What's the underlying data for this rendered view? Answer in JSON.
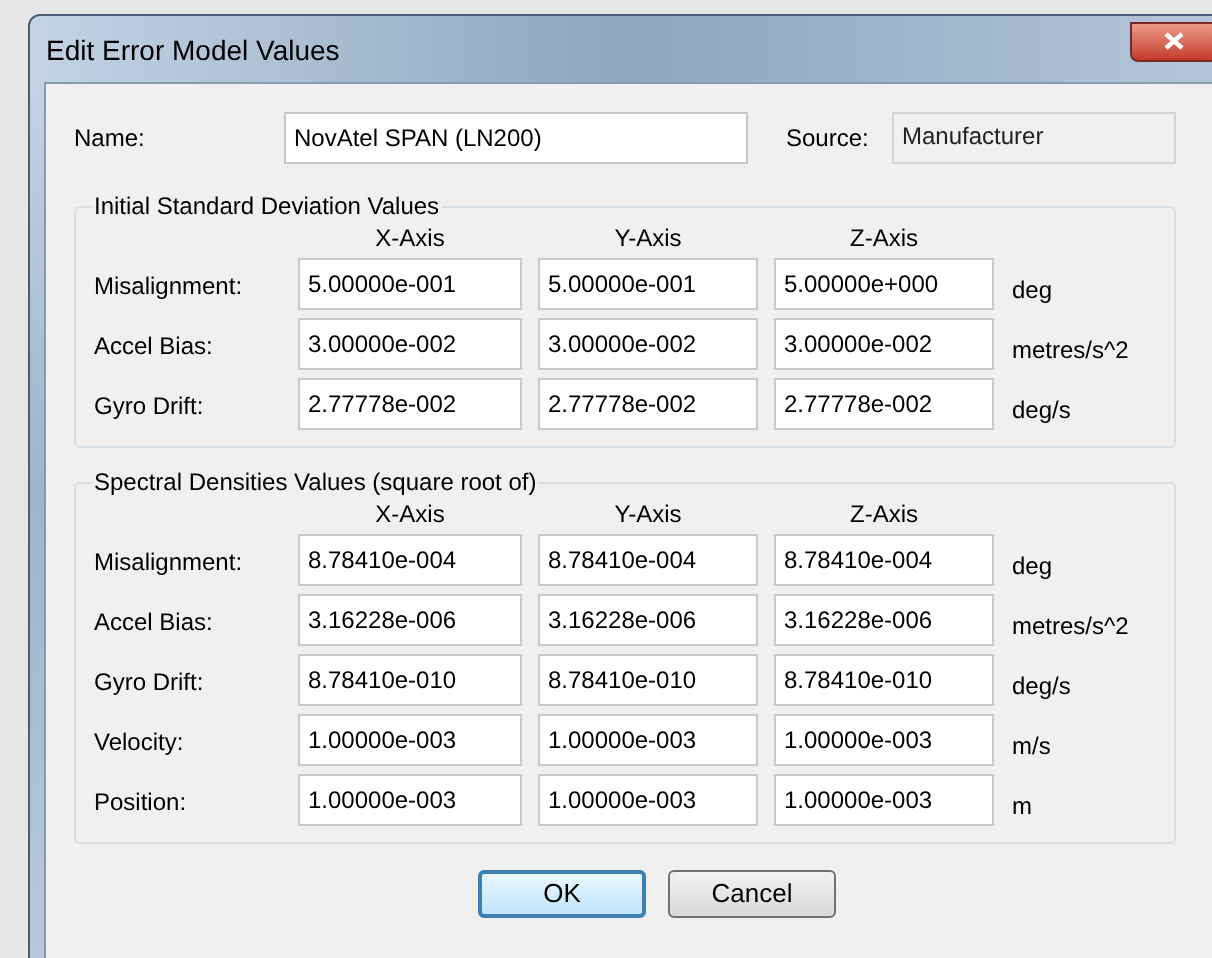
{
  "window": {
    "title": "Edit Error Model Values"
  },
  "name": {
    "label": "Name:",
    "value": "NovAtel SPAN (LN200)"
  },
  "source": {
    "label": "Source:",
    "value": "Manufacturer",
    "disabled": true
  },
  "groups": [
    {
      "title": "Initial Standard Deviation Values",
      "columns": [
        "X-Axis",
        "Y-Axis",
        "Z-Axis"
      ],
      "rows": [
        {
          "label": "Misalignment:",
          "values": [
            "5.00000e-001",
            "5.00000e-001",
            "5.00000e+000"
          ],
          "unit": "deg"
        },
        {
          "label": "Accel Bias:",
          "values": [
            "3.00000e-002",
            "3.00000e-002",
            "3.00000e-002"
          ],
          "unit": "metres/s^2"
        },
        {
          "label": "Gyro Drift:",
          "values": [
            "2.77778e-002",
            "2.77778e-002",
            "2.77778e-002"
          ],
          "unit": "deg/s"
        }
      ]
    },
    {
      "title": "Spectral Densities Values (square root of)",
      "columns": [
        "X-Axis",
        "Y-Axis",
        "Z-Axis"
      ],
      "rows": [
        {
          "label": "Misalignment:",
          "values": [
            "8.78410e-004",
            "8.78410e-004",
            "8.78410e-004"
          ],
          "unit": "deg"
        },
        {
          "label": "Accel Bias:",
          "values": [
            "3.16228e-006",
            "3.16228e-006",
            "3.16228e-006"
          ],
          "unit": "metres/s^2"
        },
        {
          "label": "Gyro Drift:",
          "values": [
            "8.78410e-010",
            "8.78410e-010",
            "8.78410e-010"
          ],
          "unit": "deg/s"
        },
        {
          "label": "Velocity:",
          "values": [
            "1.00000e-003",
            "1.00000e-003",
            "1.00000e-003"
          ],
          "unit": "m/s"
        },
        {
          "label": "Position:",
          "values": [
            "1.00000e-003",
            "1.00000e-003",
            "1.00000e-003"
          ],
          "unit": "m"
        }
      ]
    }
  ],
  "buttons": [
    {
      "label": "OK",
      "default": true
    },
    {
      "label": "Cancel",
      "default": false
    }
  ]
}
